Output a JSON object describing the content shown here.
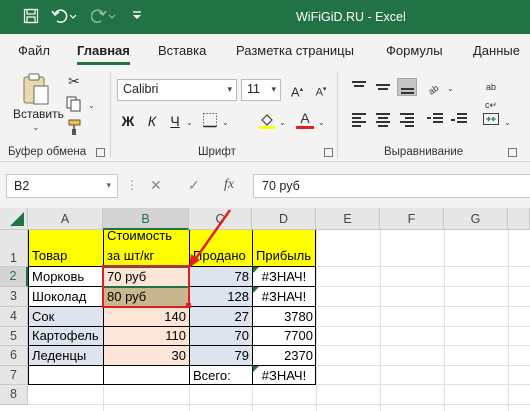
{
  "window": {
    "title": "WiFiGiD.RU  -  Excel"
  },
  "tabs": [
    "Файл",
    "Главная",
    "Вставка",
    "Разметка страницы",
    "Формулы",
    "Данные"
  ],
  "ribbon": {
    "paste_label": "Вставить",
    "clipboard_label": "Буфер обмена",
    "font_label": "Шрифт",
    "align_label": "Выравнивание",
    "font_name": "Calibri",
    "font_size": "11",
    "bold": "Ж",
    "italic": "К",
    "underline": "Ч"
  },
  "formula_bar": {
    "name_box": "B2",
    "content": "70 руб",
    "fx": "fx"
  },
  "columns": [
    "A",
    "B",
    "C",
    "D",
    "E",
    "F",
    "G"
  ],
  "rows": [
    "1",
    "2",
    "3",
    "4",
    "5",
    "6",
    "7",
    "8"
  ],
  "header": {
    "a": "Товар",
    "b1": "Стоимость",
    "b2": "за шт/кг",
    "c": "Продано",
    "d": "Прибыль"
  },
  "data": [
    {
      "a": "Морковь",
      "b": "70 руб",
      "c": "78",
      "d": "#ЗНАЧ!"
    },
    {
      "a": "Шоколад",
      "b": "80 руб",
      "c": "128",
      "d": "#ЗНАЧ!"
    },
    {
      "a": "Сок",
      "b": "140",
      "c": "27",
      "d": "3780"
    },
    {
      "a": "Картофель",
      "b": "110",
      "c": "70",
      "d": "7700"
    },
    {
      "a": "Леденцы",
      "b": "30",
      "c": "79",
      "d": "2370"
    }
  ],
  "total": {
    "label": "Всего:",
    "value": "#ЗНАЧ!"
  },
  "colors": {
    "accent": "#217346",
    "header_yellow": "#ffff00",
    "col_b_fill": "#fce4d6",
    "col_c_fill": "#dde4ee",
    "selection_red": "#e02020"
  }
}
